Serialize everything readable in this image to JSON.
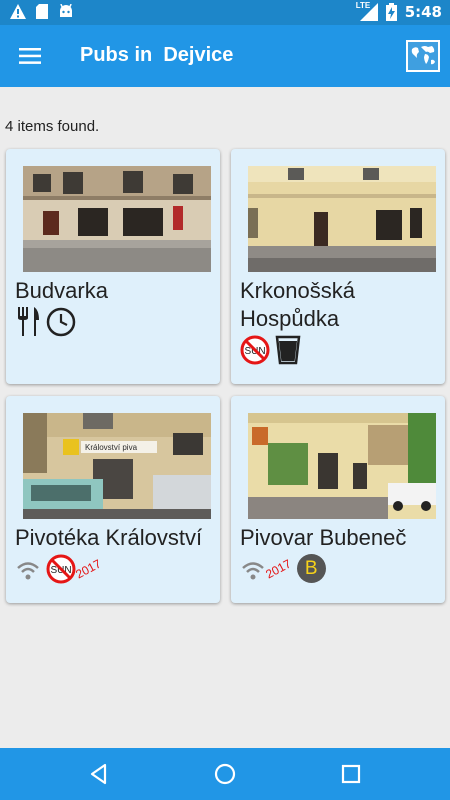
{
  "status_bar": {
    "time": "5:48",
    "network": "LTE"
  },
  "app_bar": {
    "title": "Pubs in  Dejvice"
  },
  "results_text": "4 items found.",
  "pubs": [
    {
      "name": "Budvarka",
      "icons": [
        "fork-knife-icon",
        "clock-icon"
      ]
    },
    {
      "name": "Krkonošská Hospůdka",
      "icons": [
        "no-sunday-icon",
        "glass-icon"
      ]
    },
    {
      "name": "Pivotéka Království",
      "photo_sign": "Království piva",
      "icons": [
        "wifi-icon",
        "no-sunday-icon"
      ],
      "year": "2017"
    },
    {
      "name": "Pivovar Bubeneč",
      "icons": [
        "wifi-icon",
        "b-badge-icon"
      ],
      "year": "2017",
      "badge": "B"
    }
  ],
  "sun_label": "SUN",
  "colors": {
    "primary": "#2196e6",
    "status": "#1d86c9",
    "card": "#dff0fb",
    "accent_red": "#e51616",
    "badge_text": "#f7d21a"
  }
}
